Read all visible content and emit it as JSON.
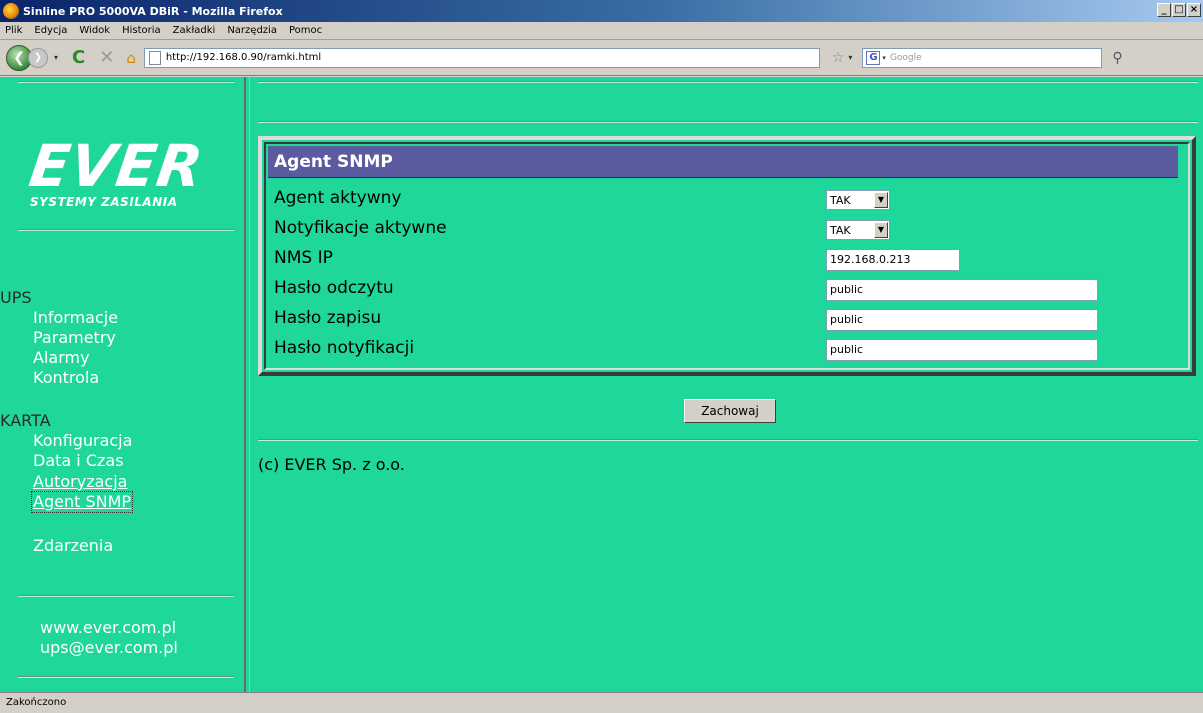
{
  "window": {
    "title": "Sinline PRO 5000VA DBiR - Mozilla Firefox",
    "minimize": "_",
    "restore": "□",
    "close": "×"
  },
  "menu": [
    "Plik",
    "Edycja",
    "Widok",
    "Historia",
    "Zakładki",
    "Narzędzia",
    "Pomoc"
  ],
  "toolbar": {
    "url": "http://192.168.0.90/ramki.html",
    "search_placeholder": "Google",
    "reload_glyph": "C",
    "stop_glyph": "✕",
    "home_glyph": "⌂",
    "back_glyph": "❮",
    "fwd_glyph": "❯",
    "star_glyph": "☆",
    "search_go_glyph": "⚲"
  },
  "sidebar": {
    "logo": "EVER",
    "logo_sub": "SYSTEMY ZASILANIA",
    "ups_heading": "UPS",
    "ups_items": [
      "Informacje",
      "Parametry",
      "Alarmy",
      "Kontrola"
    ],
    "karta_heading": "KARTA",
    "karta_items": [
      "Konfiguracja",
      "Data i Czas",
      "Autoryzacja",
      "Agent SNMP"
    ],
    "events": "Zdarzenia",
    "website": "www.ever.com.pl",
    "email": "ups@ever.com.pl"
  },
  "panel": {
    "title": "Agent SNMP",
    "rows": [
      {
        "label": "Agent aktywny",
        "value": "TAK"
      },
      {
        "label": "Notyfikacje aktywne",
        "value": "TAK"
      },
      {
        "label": "NMS IP",
        "value": "192.168.0.213"
      },
      {
        "label": "Hasło odczytu",
        "value": "public"
      },
      {
        "label": "Hasło zapisu",
        "value": "public"
      },
      {
        "label": "Hasło notyfikacji",
        "value": "public"
      }
    ],
    "save_label": "Zachowaj"
  },
  "copyright": "(c) EVER Sp. z o.o.",
  "status": "Zakończono"
}
